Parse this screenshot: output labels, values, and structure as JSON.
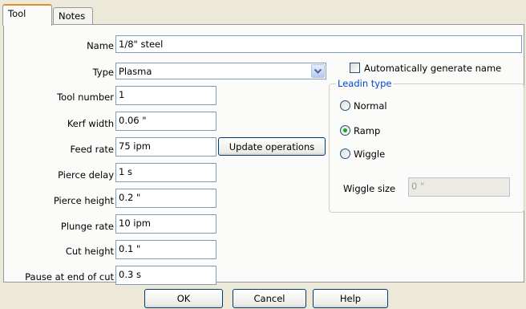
{
  "tabs": [
    {
      "label": "Tool"
    },
    {
      "label": "Notes"
    }
  ],
  "form": {
    "name": {
      "label": "Name",
      "value": "1/8\" steel"
    },
    "type": {
      "label": "Type",
      "value": "Plasma"
    },
    "tool_number": {
      "label": "Tool number",
      "value": "1"
    },
    "kerf_width": {
      "label": "Kerf width",
      "value": "0.06 \""
    },
    "feed_rate": {
      "label": "Feed rate",
      "value": "75 ipm"
    },
    "pierce_delay": {
      "label": "Pierce delay",
      "value": "1 s"
    },
    "pierce_height": {
      "label": "Pierce height",
      "value": "0.2 \""
    },
    "plunge_rate": {
      "label": "Plunge rate",
      "value": "10 ipm"
    },
    "cut_height": {
      "label": "Cut height",
      "value": "0.1 \""
    },
    "pause_end": {
      "label": "Pause at end of cut",
      "value": "0.3 s"
    }
  },
  "update_button": "Update operations",
  "auto_name": {
    "label": "Automatically generate name",
    "checked": false
  },
  "leadin": {
    "title": "Leadin type",
    "options": [
      {
        "label": "Normal",
        "selected": false
      },
      {
        "label": "Ramp",
        "selected": true
      },
      {
        "label": "Wiggle",
        "selected": false
      }
    ],
    "wiggle_label": "Wiggle size",
    "wiggle_value": "0 \""
  },
  "footer": {
    "ok": "OK",
    "cancel": "Cancel",
    "help": "Help"
  },
  "icons": {
    "dropdown": "chevron-down-icon"
  },
  "colors": {
    "tab_accent": "#e68b2c",
    "group_title": "#0046d5",
    "radio_dot": "#21a121"
  }
}
